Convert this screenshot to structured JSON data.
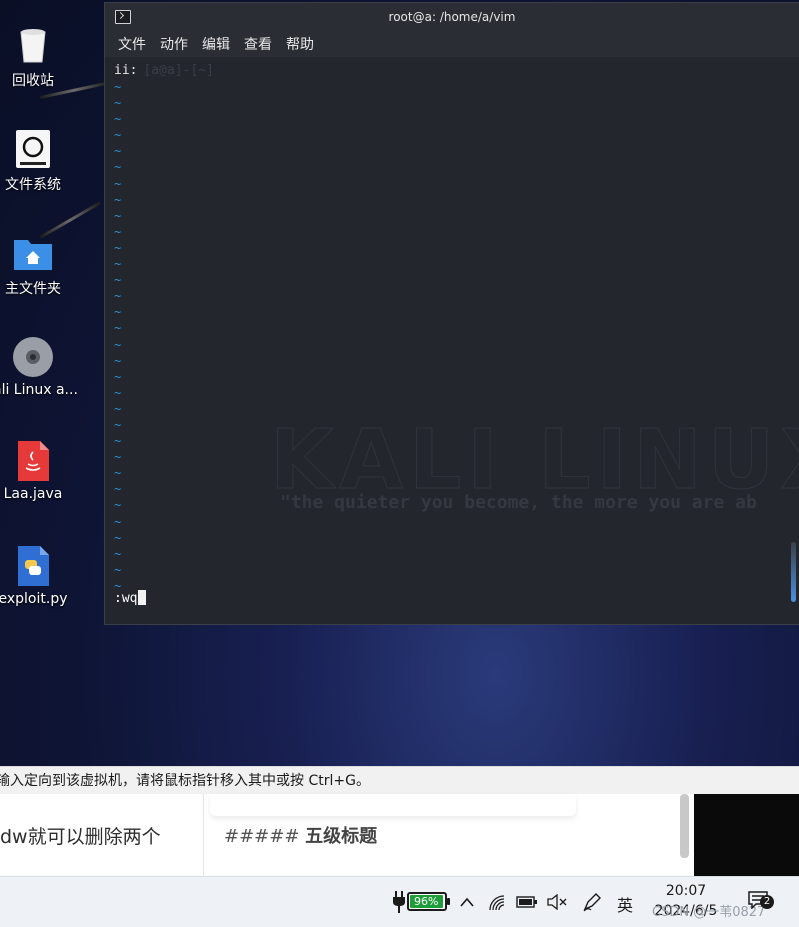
{
  "desktop": {
    "icons": [
      {
        "label": "回收站",
        "icon": "trash-icon"
      },
      {
        "label": "文件系统",
        "icon": "drive-icon"
      },
      {
        "label": "主文件夹",
        "icon": "home-folder-icon"
      },
      {
        "label": "ali Linux a...",
        "icon": "disc-icon"
      },
      {
        "label": "Laa.java",
        "icon": "java-file-icon"
      },
      {
        "label": "exploit.py",
        "icon": "python-file-icon"
      }
    ],
    "watermark_quote": "\"the quieter you become, the more you are ab"
  },
  "terminal": {
    "title": "root@a: /home/a/vim",
    "menu": [
      "文件",
      "动作",
      "编辑",
      "查看",
      "帮助"
    ],
    "first_line": "ii:",
    "command": ":wq",
    "tilde_lines": 32,
    "tilde_char": "~"
  },
  "host_notice": "输入定向到该虚拟机，请将鼠标指针移入其中或按 Ctrl+G。",
  "background_page": {
    "left_text": "dw就可以删除两个",
    "mid_prefix": "##### ",
    "mid_heading": "五级标题"
  },
  "taskbar": {
    "battery_percent": "96%",
    "ime": "英",
    "time": "20:07",
    "date": "2024/6/5",
    "watermark": "CSDN @一苇0827",
    "notification_count": "2"
  },
  "colors": {
    "tilde": "#2b8fd6",
    "battery_fill": "#1f9d3a",
    "terminal_bg": "#23262d"
  }
}
